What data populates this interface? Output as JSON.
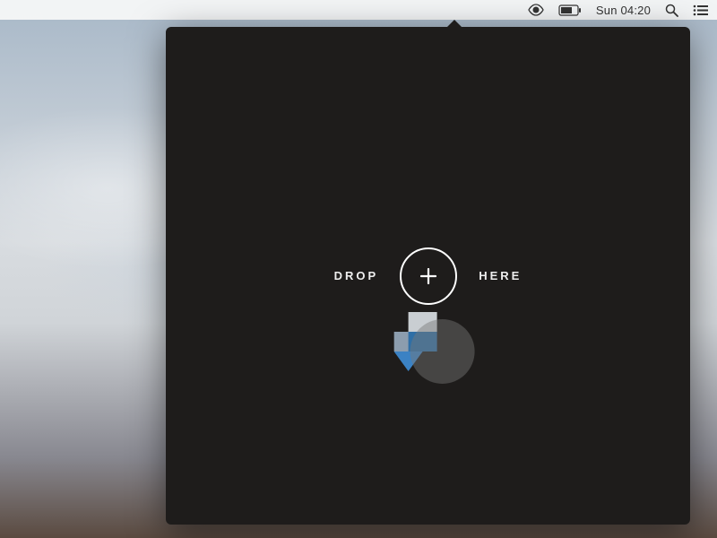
{
  "menubar": {
    "clock": "Sun 04:20"
  },
  "panel": {
    "drop_label_left": "DROP",
    "drop_label_right": "HERE"
  },
  "colors": {
    "panel_bg": "#1e1c1b",
    "accent_blue": "#3b82c4"
  }
}
